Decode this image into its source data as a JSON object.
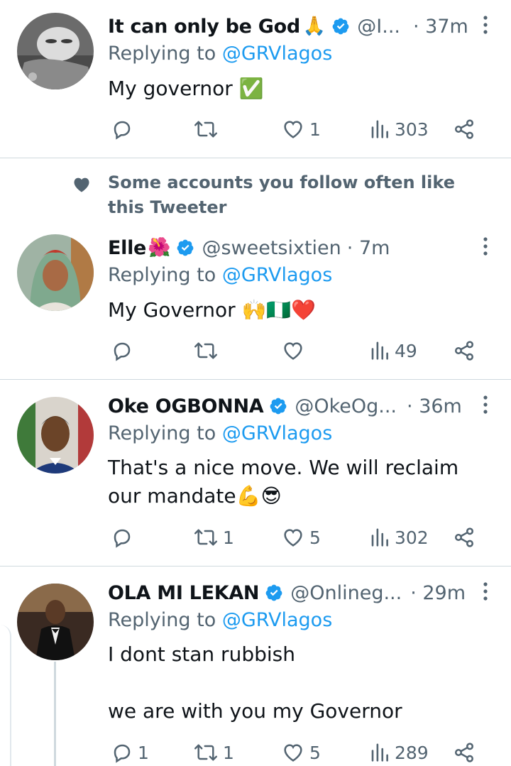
{
  "colors": {
    "text": "#0f1419",
    "secondary": "#536471",
    "link": "#1d9bf0",
    "divider": "#cfd9de",
    "verified": "#1d9bf0"
  },
  "social_context": {
    "text": "Some accounts you follow often like this Tweeter",
    "icon": "heart-icon"
  },
  "tweets": [
    {
      "name": "It can only be God",
      "name_emoji": "🙏",
      "verified": true,
      "handle": "@I...",
      "time": "· 37m",
      "replying_prefix": "Replying to ",
      "replying_mention": "@GRVlagos",
      "text": "My governor ✅",
      "reply_count": "",
      "retweet_count": "",
      "like_count": "1",
      "view_count": "303"
    },
    {
      "name": "Elle",
      "name_emoji": "🌺",
      "verified": true,
      "handle": "@sweetsixtien",
      "time": "· 7m",
      "replying_prefix": "Replying to ",
      "replying_mention": "@GRVlagos",
      "text": "My Governor 🙌🇳🇬❤️",
      "reply_count": "",
      "retweet_count": "",
      "like_count": "",
      "view_count": "49"
    },
    {
      "name": "Oke OGBONNA",
      "name_emoji": "",
      "verified": true,
      "handle": "@OkeOg...",
      "time": "· 36m",
      "replying_prefix": "Replying to ",
      "replying_mention": "@GRVlagos",
      "text": "That's a nice move. We will reclaim our mandate💪😎",
      "reply_count": "",
      "retweet_count": "1",
      "like_count": "5",
      "view_count": "302"
    },
    {
      "name": "OLA MI LEKAN",
      "name_emoji": "",
      "verified": true,
      "handle": "@Onlineg...",
      "time": "· 29m",
      "replying_prefix": "Replying to ",
      "replying_mention": "@GRVlagos",
      "text_line1": "I dont stan rubbish",
      "text_line2": "we are with you my Governor",
      "reply_count": "1",
      "retweet_count": "1",
      "like_count": "5",
      "view_count": "289"
    }
  ]
}
